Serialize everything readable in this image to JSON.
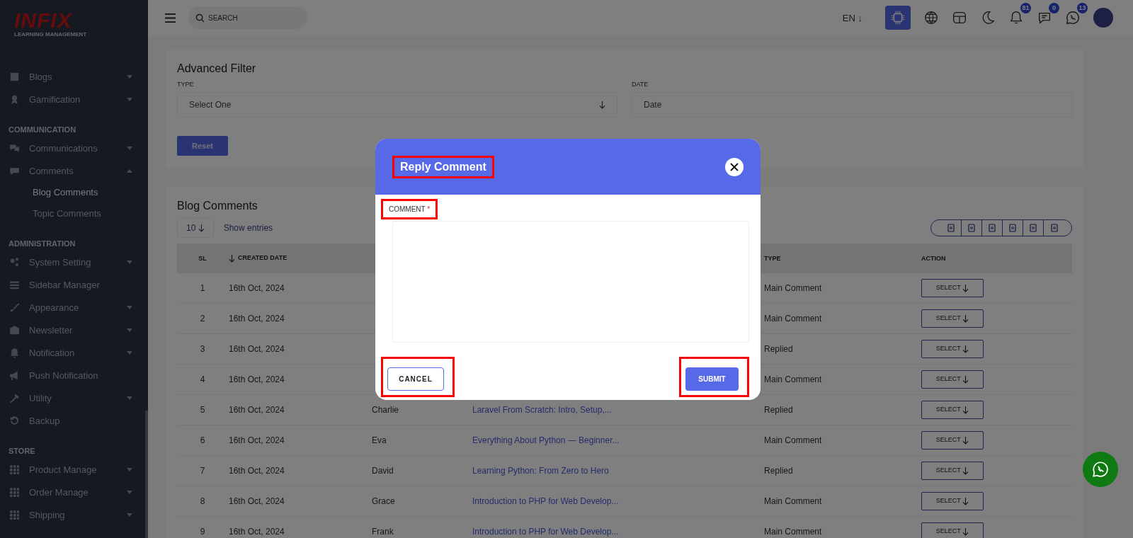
{
  "logo": {
    "brand": "INFIX",
    "tagline": "LEARNING MANAGEMENT"
  },
  "sidebar": [
    {
      "kind": "group",
      "label": "Blogs",
      "expanded": false
    },
    {
      "kind": "group",
      "label": "Gamification",
      "expanded": false
    },
    {
      "kind": "section",
      "label": "COMMUNICATION"
    },
    {
      "kind": "group",
      "label": "Communications",
      "expanded": false
    },
    {
      "kind": "group",
      "label": "Comments",
      "expanded": true,
      "children": [
        {
          "label": "Blog Comments",
          "selected": true
        },
        {
          "label": "Topic Comments",
          "selected": false
        }
      ]
    },
    {
      "kind": "section",
      "label": "ADMINISTRATION"
    },
    {
      "kind": "group",
      "label": "System Setting",
      "expanded": false
    },
    {
      "kind": "link",
      "label": "Sidebar Manager"
    },
    {
      "kind": "group",
      "label": "Appearance",
      "expanded": false
    },
    {
      "kind": "group",
      "label": "Newsletter",
      "expanded": false
    },
    {
      "kind": "group",
      "label": "Notification",
      "expanded": false
    },
    {
      "kind": "link",
      "label": "Push Notification"
    },
    {
      "kind": "group",
      "label": "Utility",
      "expanded": false
    },
    {
      "kind": "link",
      "label": "Backup"
    },
    {
      "kind": "section",
      "label": "STORE"
    },
    {
      "kind": "group",
      "label": "Product Manage",
      "expanded": false
    },
    {
      "kind": "group",
      "label": "Order Manage",
      "expanded": false
    },
    {
      "kind": "group",
      "label": "Shipping",
      "expanded": false
    }
  ],
  "header": {
    "search": {
      "placeholder": "SEARCH"
    },
    "language": "EN ↓",
    "badges": {
      "notifications": "81",
      "messages": "0",
      "chats": "13"
    }
  },
  "filter": {
    "title": "Advanced Filter",
    "type_label": "TYPE",
    "type_value": "Select One",
    "date_label": "DATE",
    "date_placeholder": "Date",
    "reset": "Reset"
  },
  "list": {
    "title": "Blog Comments",
    "page_size": "10",
    "show_entries": "Show entries",
    "columns": [
      "SL",
      "CREATED DATE",
      null,
      null,
      "TYPE",
      "ACTION"
    ],
    "rows": [
      [
        "1",
        "16th Oct, 2024",
        null,
        null,
        "Main Comment",
        "SELECT"
      ],
      [
        "2",
        "16th Oct, 2024",
        null,
        null,
        "Main Comment",
        "SELECT"
      ],
      [
        "3",
        "16th Oct, 2024",
        null,
        null,
        "Replied",
        "SELECT"
      ],
      [
        "4",
        "16th Oct, 2024",
        null,
        null,
        "Main Comment",
        "SELECT"
      ],
      [
        "5",
        "16th Oct, 2024",
        "Charlie",
        "Laravel From Scratch: Intro, Setup,...",
        "Replied",
        "SELECT"
      ],
      [
        "6",
        "16th Oct, 2024",
        "Eva",
        "Everything About Python — Beginner...",
        "Main Comment",
        "SELECT"
      ],
      [
        "7",
        "16th Oct, 2024",
        "David",
        "Learning Python: From Zero to Hero",
        "Replied",
        "SELECT"
      ],
      [
        "8",
        "16th Oct, 2024",
        "Grace",
        "Introduction to PHP for Web Develop...",
        "Main Comment",
        "SELECT"
      ],
      [
        "9",
        "16th Oct, 2024",
        "Frank",
        "Introduction to PHP for Web Develop...",
        "Main Comment",
        "SELECT"
      ]
    ]
  },
  "modal": {
    "title": "Reply Comment",
    "field_label": "COMMENT",
    "required_mark": "*",
    "cancel": "CANCEL",
    "submit": "SUBMIT"
  }
}
